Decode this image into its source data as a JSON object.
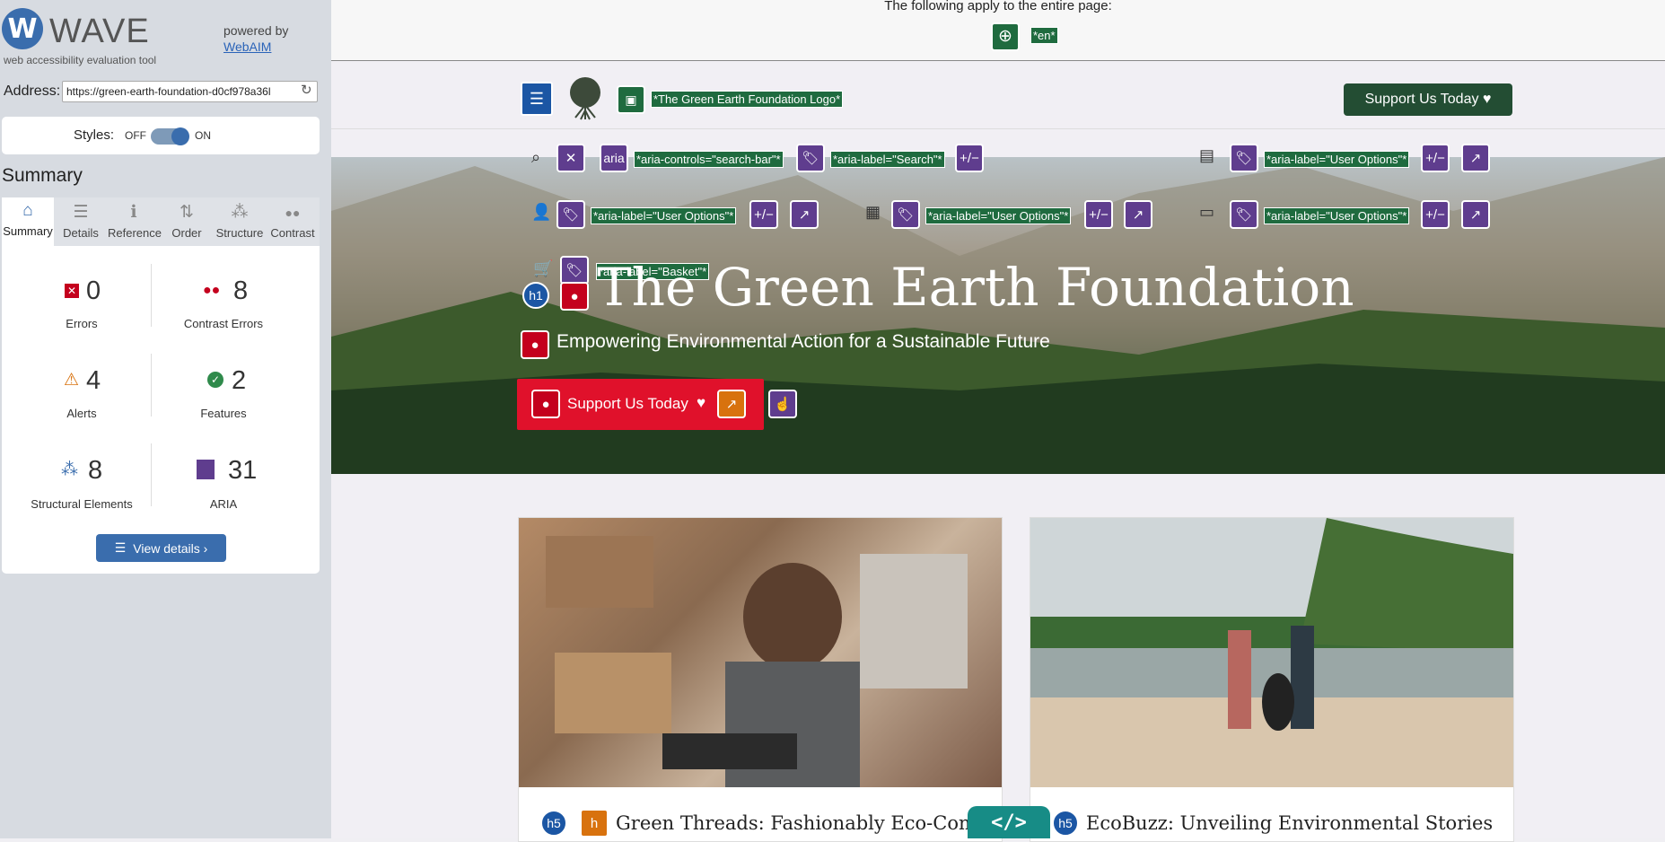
{
  "wave": {
    "logo_letter": "W",
    "title": "WAVE",
    "subtitle": "web accessibility evaluation tool",
    "powered_by": "powered by",
    "webaim_link": "WebAIM",
    "address_label": "Address:",
    "address_value": "https://green-earth-foundation-d0cf978a36l",
    "styles_label": "Styles:",
    "styles_off": "OFF",
    "styles_on": "ON",
    "summary_heading": "Summary",
    "tabs": [
      {
        "label": "Summary",
        "icon": "⌂"
      },
      {
        "label": "Details",
        "icon": "☰"
      },
      {
        "label": "Reference",
        "icon": "ℹ"
      },
      {
        "label": "Order",
        "icon": "⇅"
      },
      {
        "label": "Structure",
        "icon": "⁂"
      },
      {
        "label": "Contrast",
        "icon": "●●"
      }
    ],
    "stats": {
      "errors": {
        "value": "0",
        "label": "Errors"
      },
      "contrast": {
        "value": "8",
        "label": "Contrast Errors"
      },
      "alerts": {
        "value": "4",
        "label": "Alerts"
      },
      "features": {
        "value": "2",
        "label": "Features"
      },
      "structural": {
        "value": "8",
        "label": "Structural Elements"
      },
      "aria": {
        "value": "31",
        "label": "ARIA"
      }
    },
    "view_details": "View details ›"
  },
  "page": {
    "applies_text": "The following apply to the entire page:",
    "lang_tag": "*en*",
    "logo_alt_tag": "*The Green Earth Foundation Logo*",
    "nav_support_button": "Support Us Today",
    "heart": "♥",
    "aria_tags": {
      "search_bar": "*aria-controls=\"search-bar\"*",
      "search": "*aria-label=\"Search\"*",
      "user_options": "*aria-label=\"User Options\"*",
      "basket": "*aria-label=\"Basket\"*"
    },
    "aria_icon_text": "aria",
    "plus_minus": "+/−",
    "h1_badge": "h1",
    "h5_badge": "h5",
    "hero_title": "The Green Earth Foundation",
    "hero_subtitle": "Empowering Environmental Action for a Sustainable Future",
    "hero_button": "Support Us Today",
    "card1_title": "Green Threads: Fashionably Eco-Conscious",
    "card2_title": "EcoBuzz: Unveiling Environmental Stories",
    "code_toggle": "</>"
  },
  "colors": {
    "wave_blue": "#3a6dad",
    "aria_purple": "#5f3d8e",
    "error_red": "#c4001d",
    "alert_orange": "#d8720e",
    "tag_green": "#1f6b3f",
    "nav_button_green": "#234d33",
    "hero_button_red": "#e0112b"
  }
}
